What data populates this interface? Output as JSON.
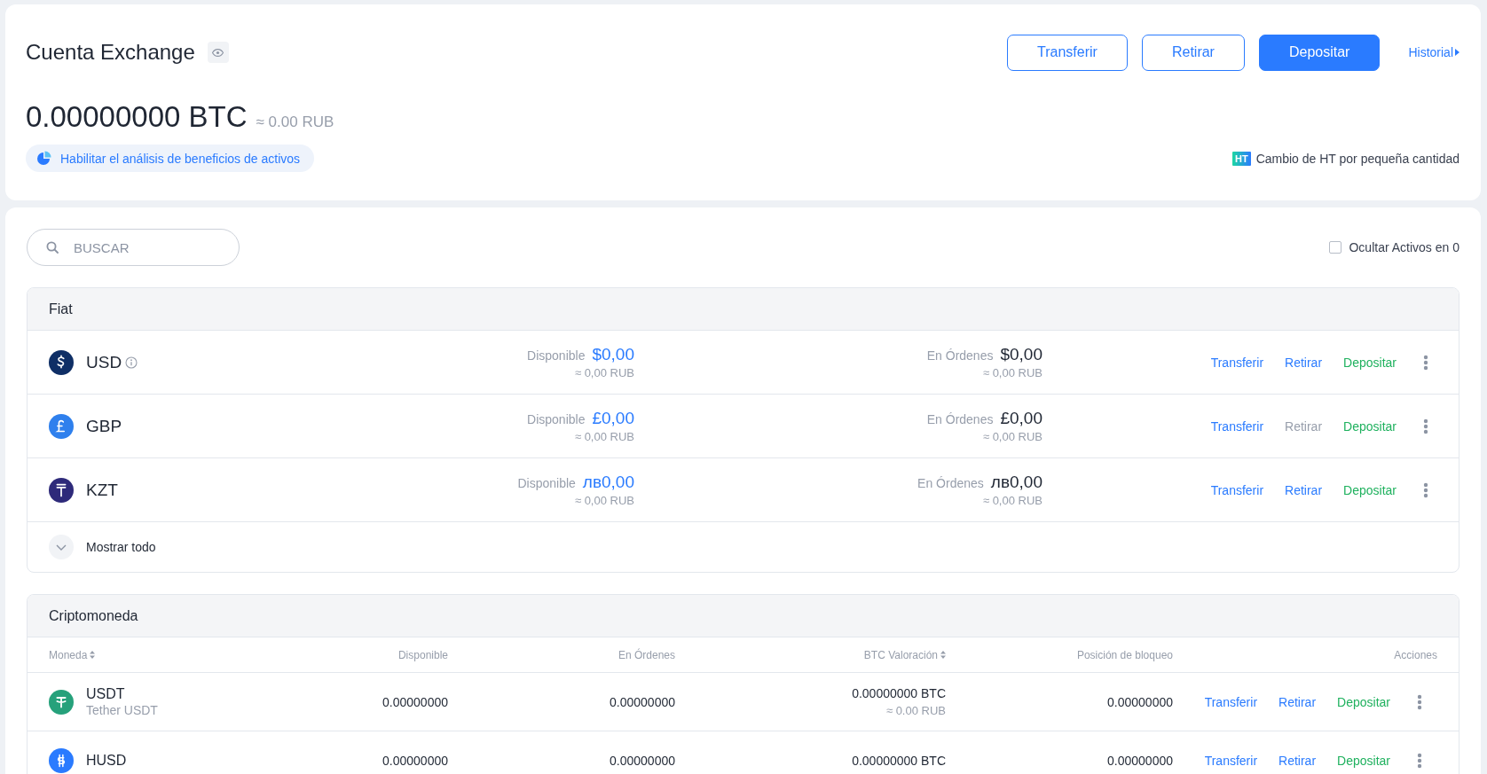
{
  "account": {
    "title": "Cuenta Exchange",
    "balance": "0.00000000 BTC",
    "balance_fiat": "≈ 0.00 RUB",
    "analysis_link": "Habilitar el análisis de beneficios de activos",
    "buttons": [
      {
        "label": "Transferir",
        "primary": false
      },
      {
        "label": "Retirar",
        "primary": false
      },
      {
        "label": "Depositar",
        "primary": true
      }
    ],
    "history_link": "Historial",
    "small_exchange": {
      "badge": "HT",
      "label": "Cambio de HT por pequeña cantidad"
    }
  },
  "search": {
    "placeholder": "BUSCAR"
  },
  "hide_zero": {
    "label": "Ocultar Activos en 0",
    "checked": false
  },
  "fiat": {
    "title": "Fiat",
    "rows": [
      {
        "name": "USD",
        "info": true,
        "available_label": "Disponible",
        "available": "$0,00",
        "available_fiat": "≈ 0,00 RUB",
        "orders_label": "En Órdenes",
        "orders": "$0,00",
        "orders_fiat": "≈ 0,00 RUB",
        "actions": [
          {
            "label": "Transferir",
            "kind": "transfer",
            "disabled": false
          },
          {
            "label": "Retirar",
            "kind": "withdraw",
            "disabled": false
          },
          {
            "label": "Depositar",
            "kind": "deposit",
            "disabled": false
          }
        ]
      },
      {
        "name": "GBP",
        "info": false,
        "available_label": "Disponible",
        "available": "£0,00",
        "available_fiat": "≈ 0,00 RUB",
        "orders_label": "En Órdenes",
        "orders": "£0,00",
        "orders_fiat": "≈ 0,00 RUB",
        "actions": [
          {
            "label": "Transferir",
            "kind": "transfer",
            "disabled": false
          },
          {
            "label": "Retirar",
            "kind": "withdraw",
            "disabled": true
          },
          {
            "label": "Depositar",
            "kind": "deposit",
            "disabled": false
          }
        ]
      },
      {
        "name": "KZT",
        "info": false,
        "available_label": "Disponible",
        "available": "лв0,00",
        "available_fiat": "≈ 0,00 RUB",
        "orders_label": "En Órdenes",
        "orders": "лв0,00",
        "orders_fiat": "≈ 0,00 RUB",
        "actions": [
          {
            "label": "Transferir",
            "kind": "transfer",
            "disabled": false
          },
          {
            "label": "Retirar",
            "kind": "withdraw",
            "disabled": false
          },
          {
            "label": "Depositar",
            "kind": "deposit",
            "disabled": false
          }
        ]
      }
    ],
    "show_all": "Mostrar todo"
  },
  "crypto": {
    "title": "Criptomoneda",
    "columns": [
      {
        "label": "Moneda",
        "sortable": true
      },
      {
        "label": "Disponible",
        "sortable": false
      },
      {
        "label": "En Órdenes",
        "sortable": false
      },
      {
        "label": "BTC Valoración",
        "sortable": true
      },
      {
        "label": "Posición de bloqueo",
        "sortable": false
      },
      {
        "label": "Acciones",
        "sortable": false
      }
    ],
    "rows": [
      {
        "name": "USDT",
        "subtitle": "Tether USDT",
        "available": "0.00000000",
        "orders": "0.00000000",
        "btc_value": "0.00000000 BTC",
        "btc_value_fiat": "≈ 0.00 RUB",
        "locked": "0.00000000",
        "actions": [
          {
            "label": "Transferir",
            "kind": "transfer",
            "disabled": false
          },
          {
            "label": "Retirar",
            "kind": "withdraw",
            "disabled": false
          },
          {
            "label": "Depositar",
            "kind": "deposit",
            "disabled": false
          }
        ]
      },
      {
        "name": "HUSD",
        "available": "0.00000000",
        "orders": "0.00000000",
        "btc_value": "0.00000000 BTC",
        "locked": "0.00000000",
        "actions": [
          {
            "label": "Transferir",
            "kind": "transfer",
            "disabled": false
          },
          {
            "label": "Retirar",
            "kind": "withdraw",
            "disabled": false
          },
          {
            "label": "Depositar",
            "kind": "deposit",
            "disabled": false
          }
        ]
      }
    ]
  }
}
